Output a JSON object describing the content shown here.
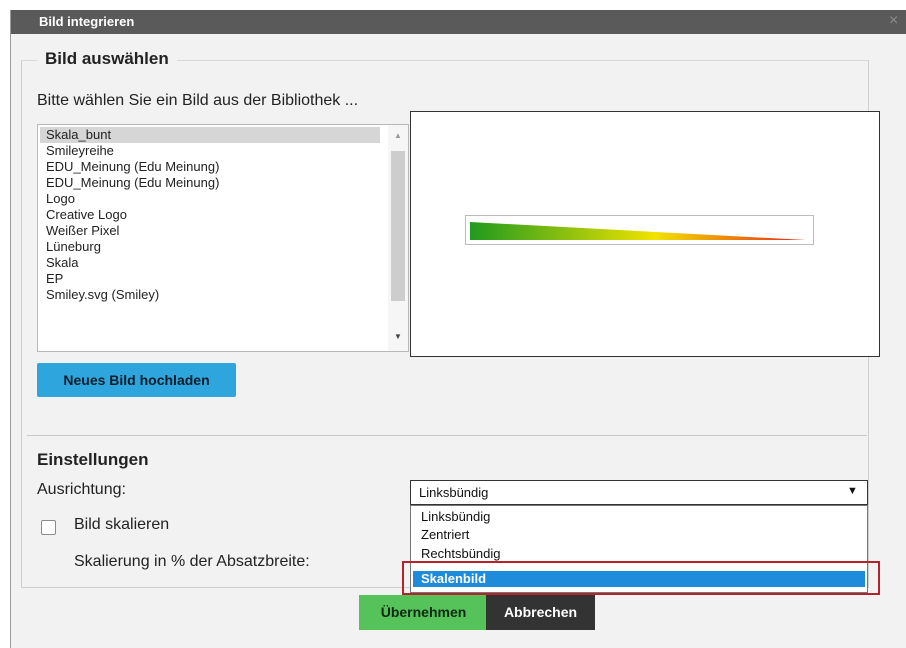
{
  "dialog": {
    "title": "Bild integrieren",
    "close_label": "×"
  },
  "image_section": {
    "legend": "Bild auswählen",
    "intro": "Bitte wählen Sie ein Bild aus der Bibliothek ...",
    "library_items": [
      "Skala_bunt",
      "Smileyreihe",
      "EDU_Meinung (Edu Meinung)",
      "EDU_Meinung (Edu Meinung)",
      "Logo",
      "Creative Logo",
      "Weißer Pixel",
      "Lüneburg",
      "Skala",
      "EP",
      "Smiley.svg (Smiley)"
    ],
    "selected_item": "Skala_bunt",
    "upload_button": "Neues Bild hochladen",
    "preview_gradient_colors": [
      "#1f9a1f",
      "#f1e300",
      "#e8231a"
    ]
  },
  "settings": {
    "title": "Einstellungen",
    "alignment_label": "Ausrichtung:",
    "alignment_value": "Linksbündig",
    "alignment_options": [
      "Linksbündig",
      "Zentriert",
      "Rechtsbündig",
      "Skalenbild"
    ],
    "highlighted_option": "Skalenbild",
    "scale_checkbox_label": "Bild skalieren",
    "scale_checked": false,
    "scale_percent_label": "Skalierung in % der Absatzbreite:"
  },
  "buttons": {
    "apply": "Übernehmen",
    "cancel": "Abbrechen"
  },
  "colors": {
    "titlebar": "#5a5a5a",
    "upload_button": "#2ea6dd",
    "apply_button": "#55c35a",
    "cancel_button": "#333333",
    "highlight": "#1e8bdb",
    "callout_border": "#b7232c"
  }
}
